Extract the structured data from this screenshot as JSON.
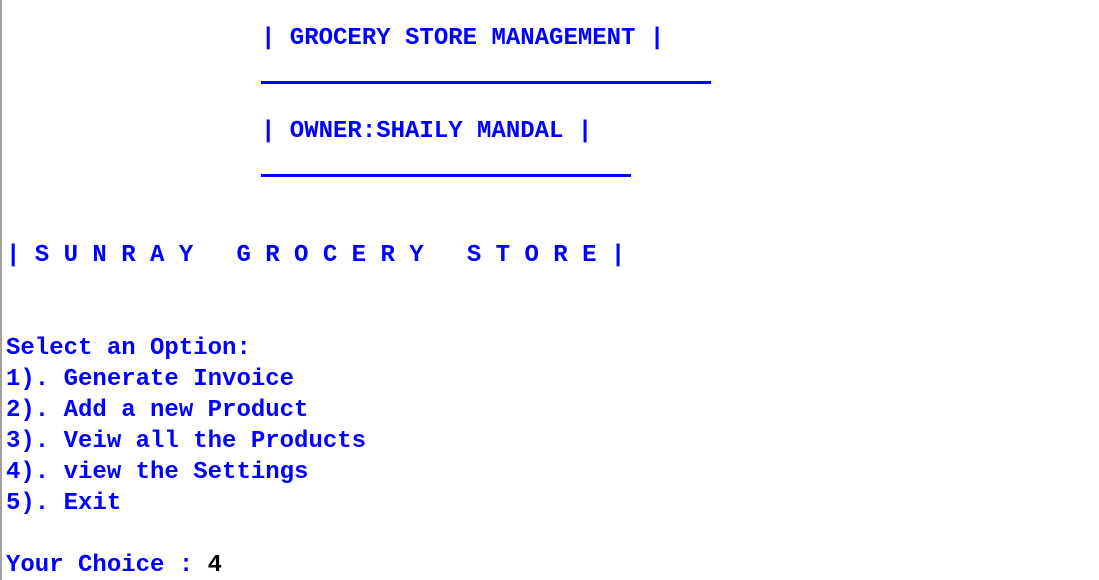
{
  "header": {
    "title": "| GROCERY STORE MANAGEMENT |",
    "owner": "| OWNER:SHAILY MANDAL |"
  },
  "store_banner": "| S U N R A Y   G R O C E R Y   S T O R E |",
  "menu": {
    "prompt": "Select an Option:",
    "options": [
      "1). Generate Invoice",
      "2). Add a new Product",
      "3). Veiw all the Products",
      "4). view the Settings",
      "5). Exit"
    ]
  },
  "choice": {
    "label": "Your Choice : ",
    "value": "4"
  },
  "colors": {
    "text": "#0000ff",
    "input": "#000000",
    "background": "#ffffff"
  }
}
